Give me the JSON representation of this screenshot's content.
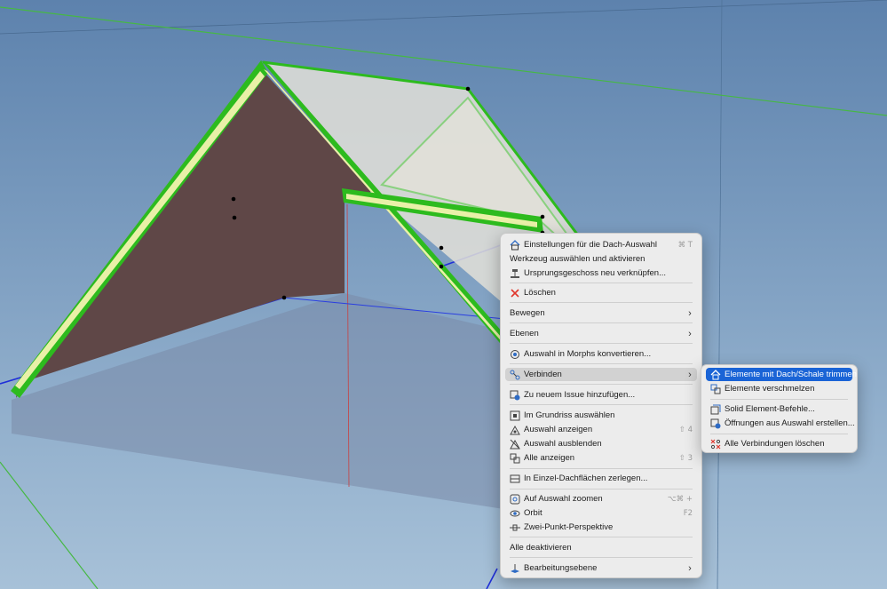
{
  "context_menu": {
    "items": [
      {
        "label": "Einstellungen für die Dach-Auswahl",
        "shortcut": "⌘ T",
        "icon": "roof-settings-icon"
      },
      {
        "label": "Werkzeug auswählen und aktivieren"
      },
      {
        "label": "Ursprungsgeschoss neu verknüpfen...",
        "icon": "story-link-icon"
      },
      {
        "label": "Löschen",
        "icon": "delete-x-icon"
      },
      {
        "label": "Bewegen",
        "submenu": true
      },
      {
        "label": "Ebenen",
        "submenu": true
      },
      {
        "label": "Auswahl in Morphs konvertieren...",
        "icon": "morph-convert-icon"
      },
      {
        "label": "Verbinden",
        "submenu": true,
        "icon": "connect-icon"
      },
      {
        "label": "Zu neuem Issue hinzufügen...",
        "icon": "issue-add-icon"
      },
      {
        "label": "Im Grundriss auswählen",
        "icon": "floor-plan-select-icon"
      },
      {
        "label": "Auswahl anzeigen",
        "shortcut": "⇧ 4",
        "icon": "show-selection-icon"
      },
      {
        "label": "Auswahl ausblenden",
        "icon": "hide-selection-icon"
      },
      {
        "label": "Alle anzeigen",
        "shortcut": "⇧ 3",
        "icon": "show-all-icon"
      },
      {
        "label": "In Einzel-Dachflächen zerlegen...",
        "icon": "split-roof-icon"
      },
      {
        "label": "Auf Auswahl zoomen",
        "shortcut": "⌥⌘ +",
        "icon": "zoom-selection-icon"
      },
      {
        "label": "Orbit",
        "shortcut": "F2",
        "icon": "orbit-icon"
      },
      {
        "label": "Zwei-Punkt-Perspektive",
        "icon": "two-point-perspective-icon"
      },
      {
        "label": "Alle deaktivieren"
      },
      {
        "label": "Bearbeitungsebene",
        "submenu": true,
        "icon": "editing-plane-icon"
      }
    ]
  },
  "submenu": {
    "items": [
      {
        "label": "Elemente mit Dach/Schale trimmen",
        "icon": "trim-roof-icon"
      },
      {
        "label": "Elemente verschmelzen",
        "icon": "merge-elements-icon"
      },
      {
        "label": "Solid Element-Befehle...",
        "icon": "solid-element-icon"
      },
      {
        "label": "Öffnungen aus Auswahl erstellen...",
        "icon": "create-openings-icon"
      },
      {
        "label": "Alle Verbindungen löschen",
        "icon": "delete-connections-icon"
      }
    ]
  },
  "colors": {
    "highlight": "#1a64d6",
    "hover": "#d2d2d2",
    "roof_edge": "#2dbb1e",
    "roof_core": "#e9f0a8",
    "gable_fill": "#5f4747",
    "sky_top": "#5d82ad",
    "sky_bottom": "#a7c1d8"
  }
}
